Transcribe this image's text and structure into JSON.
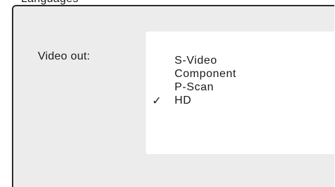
{
  "header": {
    "title": "Languages"
  },
  "panel": {
    "setting_label": "Video out:",
    "options": [
      {
        "label": "S-Video",
        "selected": false
      },
      {
        "label": "Component",
        "selected": false
      },
      {
        "label": "P-Scan",
        "selected": false
      },
      {
        "label": "HD",
        "selected": true
      }
    ],
    "check_glyph": "✓",
    "check_icon": "check-icon"
  }
}
